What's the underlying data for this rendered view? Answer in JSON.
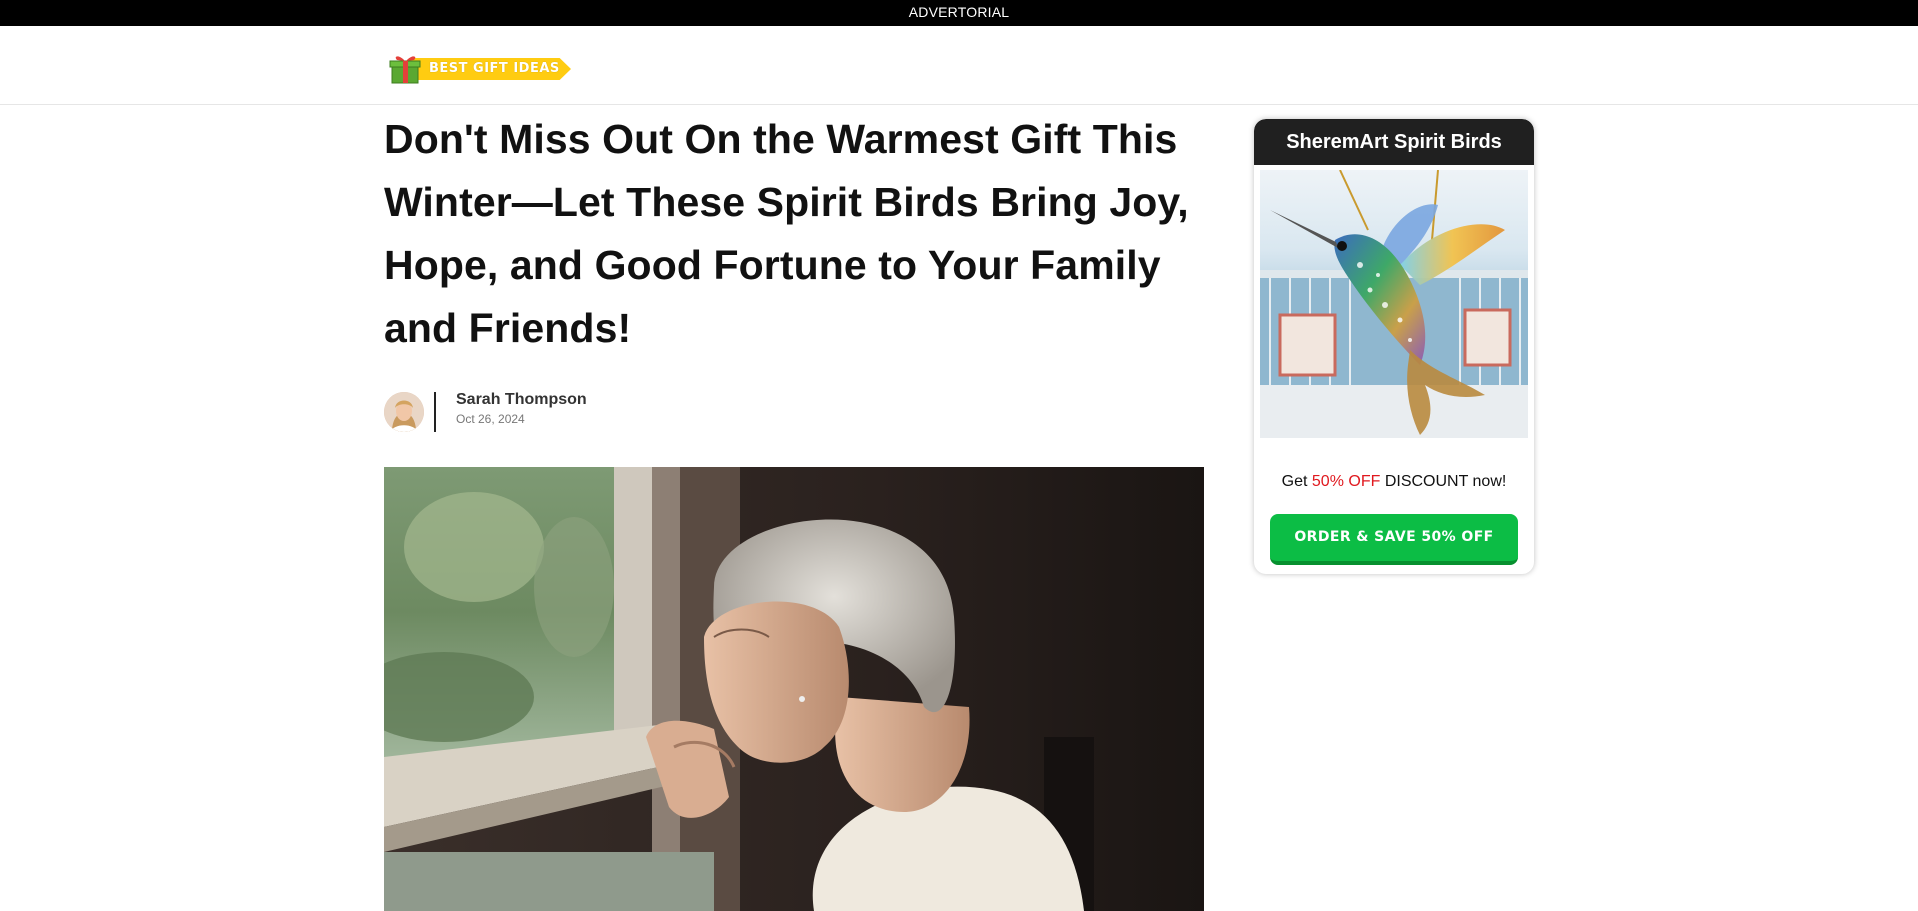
{
  "topbar": {
    "label": "ADVERTORIAL"
  },
  "header": {
    "logo_text": "BEST GIFT IDEAS"
  },
  "article": {
    "headline": "Don't Miss Out On the Warmest Gift This Winter—Let These Spirit Birds Bring Joy, Hope, and Good Fortune to Your Family and Friends!",
    "author": "Sarah Thompson",
    "date": "Oct 26, 2024"
  },
  "sidebar": {
    "title": "SheremArt Spirit Birds",
    "promo_prefix": "Get ",
    "promo_highlight": "50% OFF",
    "promo_suffix": " DISCOUNT now!",
    "cta_label": "ORDER & SAVE 50% OFF"
  },
  "colors": {
    "topbar_bg": "#000000",
    "logo_ribbon": "#ffcc11",
    "sidebar_title_bg": "#202020",
    "promo_red": "#e0191f",
    "cta_green": "#0cbd45"
  },
  "icons": [
    "gift-box-icon"
  ]
}
